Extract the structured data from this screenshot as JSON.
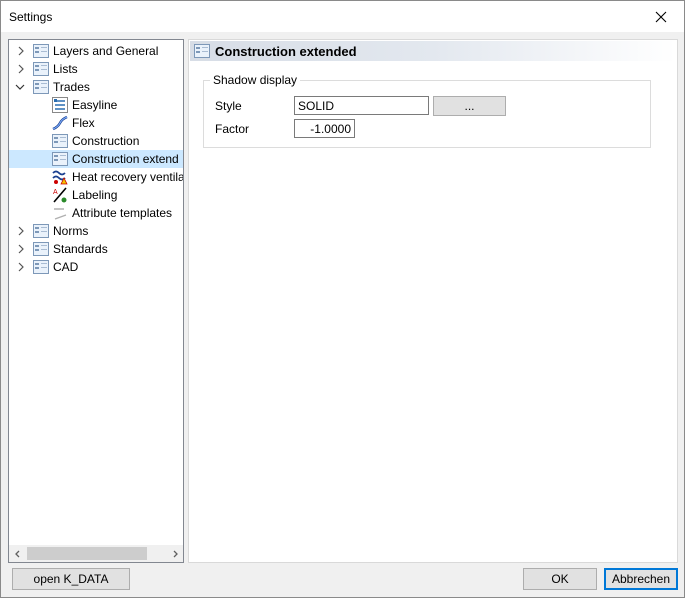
{
  "window": {
    "title": "Settings"
  },
  "tree": {
    "items": [
      {
        "label": "Layers and General",
        "icon": "settings-page-icon",
        "expander": "collapsed"
      },
      {
        "label": "Lists",
        "icon": "settings-page-icon",
        "expander": "collapsed"
      },
      {
        "label": "Trades",
        "icon": "settings-page-icon",
        "expander": "expanded"
      },
      {
        "label": "Easyline",
        "icon": "easyline-icon"
      },
      {
        "label": "Flex",
        "icon": "flex-icon"
      },
      {
        "label": "Construction",
        "icon": "settings-page-icon"
      },
      {
        "label": "Construction extend",
        "icon": "settings-page-icon",
        "selected": true
      },
      {
        "label": "Heat recovery ventila",
        "icon": "heat-recovery-icon"
      },
      {
        "label": "Labeling",
        "icon": "labeling-icon"
      },
      {
        "label": "Attribute templates",
        "icon": "attribute-templates-icon"
      },
      {
        "label": "Norms",
        "icon": "settings-page-icon",
        "expander": "collapsed"
      },
      {
        "label": "Standards",
        "icon": "settings-page-icon",
        "expander": "collapsed"
      },
      {
        "label": "CAD",
        "icon": "settings-page-icon",
        "expander": "collapsed"
      }
    ]
  },
  "panel": {
    "title": "Construction extended",
    "group": {
      "legend": "Shadow display",
      "style_label": "Style",
      "style_value": "SOLID",
      "browse_label": "...",
      "factor_label": "Factor",
      "factor_value": "-1.0000"
    }
  },
  "buttons": {
    "open_kdata": "open K_DATA",
    "ok": "OK",
    "cancel": "Abbrechen"
  },
  "colors": {
    "selection": "#cce8ff",
    "default_button_border": "#0078d7"
  }
}
